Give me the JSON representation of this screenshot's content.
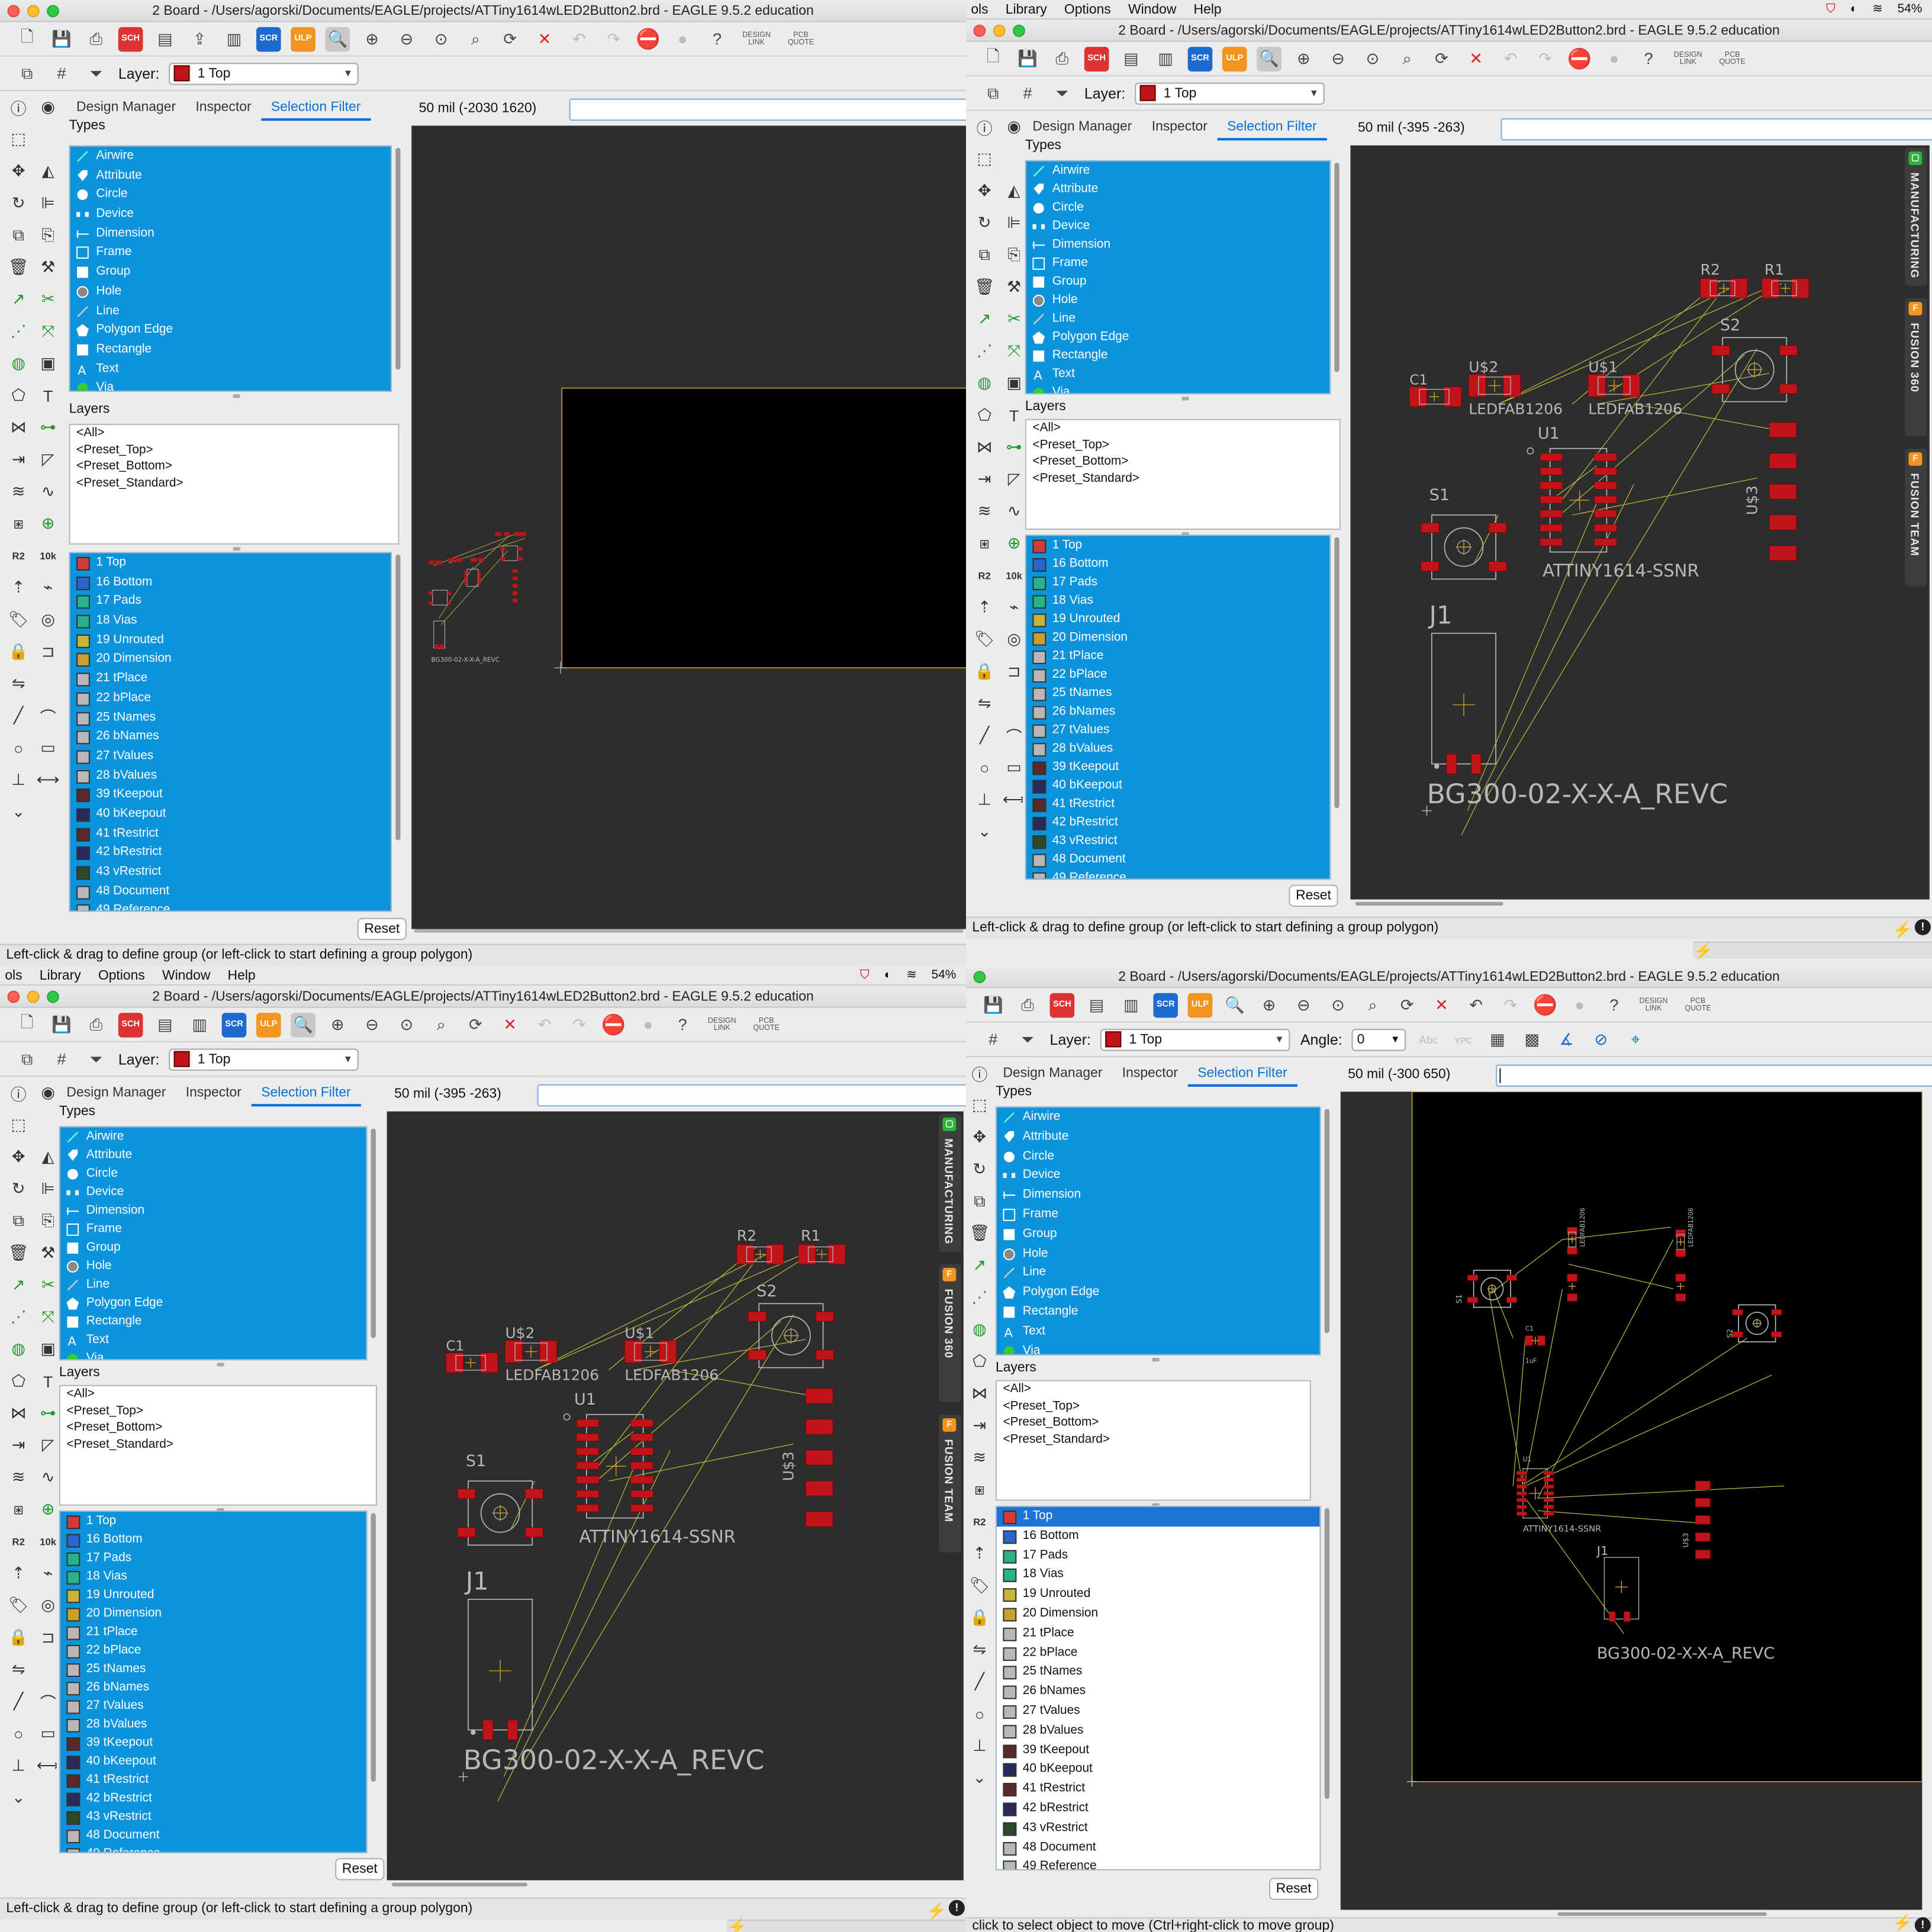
{
  "window_title": "2 Board - /Users/agorski/Documents/EAGLE/projects/ATTiny1614wLED2Button2.brd - EAGLE 9.5.2 education",
  "menubar": {
    "items": [
      "Library",
      "Options",
      "Window",
      "Help"
    ],
    "items_cut": [
      "ols",
      "Library",
      "Options",
      "Window",
      "Help"
    ],
    "battery": "54%"
  },
  "toolbar": {
    "sch_label": "SCH",
    "scr_label": "SCR",
    "ulp_label": "ULP",
    "design_link": "DESIGN LINK",
    "pcb_quote": "PCB QUOTE",
    "help": "?"
  },
  "layer_bar": {
    "label": "Layer:",
    "value": "1 Top",
    "angle_label": "Angle:",
    "angle_value": "0",
    "active_color": "#c0141a"
  },
  "panel_tabs": [
    "Design Manager",
    "Inspector",
    "Selection Filter"
  ],
  "types_label": "Types",
  "layers_label": "Layers",
  "types": [
    {
      "label": "Airwire",
      "icon": "airwire-icon"
    },
    {
      "label": "Attribute",
      "icon": "tag-icon"
    },
    {
      "label": "Circle",
      "icon": "circle-icon"
    },
    {
      "label": "Device",
      "icon": "device-icon"
    },
    {
      "label": "Dimension",
      "icon": "dimension-icon"
    },
    {
      "label": "Frame",
      "icon": "frame-icon"
    },
    {
      "label": "Group",
      "icon": "group-icon"
    },
    {
      "label": "Hole",
      "icon": "hole-icon"
    },
    {
      "label": "Line",
      "icon": "line-icon"
    },
    {
      "label": "Polygon Edge",
      "icon": "polygon-icon"
    },
    {
      "label": "Rectangle",
      "icon": "rectangle-icon"
    },
    {
      "label": "Text",
      "icon": "text-icon"
    },
    {
      "label": "Via",
      "icon": "via-icon"
    }
  ],
  "layer_presets": [
    "<All>",
    "<Preset_Top>",
    "<Preset_Bottom>",
    "<Preset_Standard>"
  ],
  "layers": [
    {
      "label": "1 Top",
      "color": "#d23b3b"
    },
    {
      "label": "16 Bottom",
      "color": "#2a66c8"
    },
    {
      "label": "17 Pads",
      "color": "#2bb08a"
    },
    {
      "label": "18 Vias",
      "color": "#2bb08a"
    },
    {
      "label": "19 Unrouted",
      "color": "#c8b43a"
    },
    {
      "label": "20 Dimension",
      "color": "#c8a030"
    },
    {
      "label": "21 tPlace",
      "color": "#b8b8b8"
    },
    {
      "label": "22 bPlace",
      "color": "#b8b8b8"
    },
    {
      "label": "25 tNames",
      "color": "#b8b8b8"
    },
    {
      "label": "26 bNames",
      "color": "#b8b8b8"
    },
    {
      "label": "27 tValues",
      "color": "#b8b8b8"
    },
    {
      "label": "28 bValues",
      "color": "#b8b8b8"
    },
    {
      "label": "39 tKeepout",
      "color": "#5a2a2a"
    },
    {
      "label": "40 bKeepout",
      "color": "#2a2a5a"
    },
    {
      "label": "41 tRestrict",
      "color": "#5a2a2a"
    },
    {
      "label": "42 bRestrict",
      "color": "#2a2a5a"
    },
    {
      "label": "43 vRestrict",
      "color": "#2a4a2a"
    },
    {
      "label": "48 Document",
      "color": "#b8b8b8"
    },
    {
      "label": "49 Reference",
      "color": "#b8b8b8"
    }
  ],
  "reset_label": "Reset",
  "coords": {
    "tl": "50 mil (-2030 1620)",
    "tr": "50 mil (-395 -263)",
    "bl": "50 mil (-395 -263)",
    "br": "50 mil (-300 650)"
  },
  "status": {
    "group": "Left-click & drag to define group (or left-click to start defining a group polygon)",
    "move": "click to select object to move (Ctrl+right-click to move group)"
  },
  "sidetabs": [
    "MANUFACTURING",
    "FUSION 360",
    "FUSION TEAM"
  ],
  "board_labels": {
    "r2": "R2",
    "r1": "R1",
    "s2": "S2",
    "s1": "S1",
    "c1": "C1",
    "us2": "U$2",
    "us1": "U$1",
    "us3": "U$3",
    "u1": "U1",
    "j1": "J1",
    "led1": "LEDFAB1206",
    "led2": "LEDFAB1206",
    "mcu": "ATTINY1614-SSNR",
    "conn": "BG300-02-X-X-A_REVC",
    "cap": "1uF"
  }
}
